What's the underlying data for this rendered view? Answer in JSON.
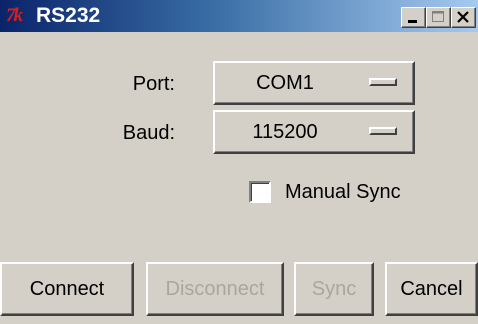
{
  "window": {
    "title": "RS232",
    "app_icon": "tk-feather-icon",
    "controls": [
      "minimize-icon",
      "maximize-icon",
      "close-icon"
    ]
  },
  "form": {
    "port": {
      "label": "Port:",
      "value": "COM1"
    },
    "baud": {
      "label": "Baud:",
      "value": "115200"
    },
    "manual_sync": {
      "label": "Manual Sync",
      "checked": false
    }
  },
  "buttons": {
    "connect": {
      "label": "Connect",
      "enabled": true
    },
    "disconnect": {
      "label": "Disconnect",
      "enabled": false
    },
    "sync": {
      "label": "Sync",
      "enabled": false
    },
    "cancel": {
      "label": "Cancel",
      "enabled": true
    }
  },
  "colors": {
    "titlebar_start": "#0a246a",
    "titlebar_end": "#a6caf0",
    "window_bg": "#d4d0c8",
    "disabled_text": "#a9a6a0",
    "tk_logo": "#d42020"
  }
}
